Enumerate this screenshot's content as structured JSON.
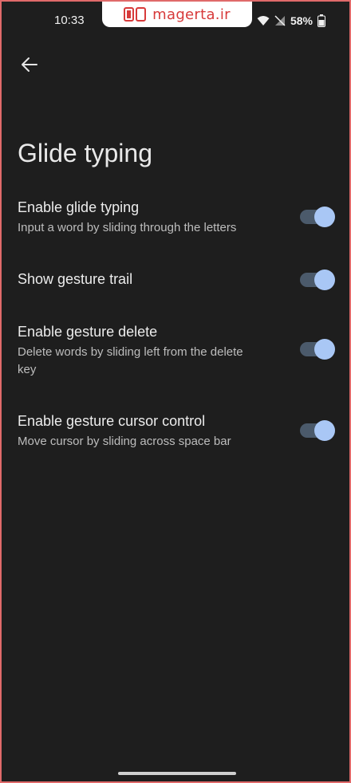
{
  "status_bar": {
    "time": "10:33",
    "watermark_text": "magerta.ir",
    "battery": "58%",
    "icons": [
      "wifi-icon",
      "no-signal-icon",
      "battery-icon"
    ]
  },
  "top_bar": {
    "back_icon": "arrow-left-icon"
  },
  "page": {
    "title": "Glide typing"
  },
  "settings": [
    {
      "title": "Enable glide typing",
      "subtitle": "Input a word by sliding through the letters",
      "enabled": true
    },
    {
      "title": "Show gesture trail",
      "subtitle": "",
      "enabled": true
    },
    {
      "title": "Enable gesture delete",
      "subtitle": "Delete words by sliding left from the delete key",
      "enabled": true
    },
    {
      "title": "Enable gesture cursor control",
      "subtitle": "Move cursor by sliding across space bar",
      "enabled": true
    }
  ],
  "colors": {
    "background": "#1e1e1e",
    "toggle_thumb": "#a9c7f5",
    "toggle_track": "#4b5a6b",
    "frame_border": "#e06a6a",
    "watermark_red": "#d73a3a"
  }
}
